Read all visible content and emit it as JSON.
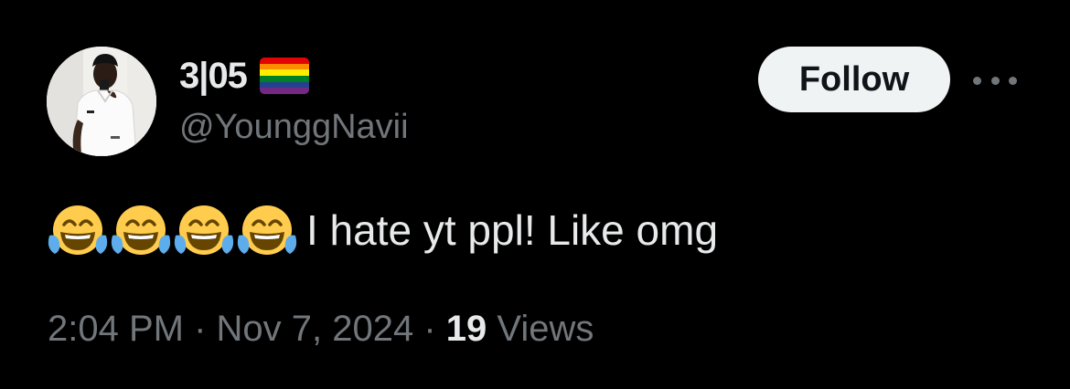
{
  "author": {
    "display_name": "3|05",
    "handle": "@YounggNavii",
    "badge_icon": "pride-flag-icon",
    "flag_colors": [
      "#e40303",
      "#ff8c00",
      "#ffed00",
      "#008026",
      "#24408e",
      "#732982"
    ]
  },
  "actions": {
    "follow_label": "Follow",
    "more_icon": "more-horizontal-icon"
  },
  "tweet": {
    "emoji_icon": "face-with-tears-of-joy-icon",
    "emoji_count": 4,
    "text": "I hate yt ppl! Like omg"
  },
  "meta": {
    "time": "2:04 PM",
    "separator": " · ",
    "date": "Nov 7, 2024",
    "views_count": "19",
    "views_label": "Views"
  },
  "colors": {
    "background": "#000000",
    "primary_text": "#e7e9ea",
    "secondary_text": "#71767b",
    "follow_bg": "#eff3f4"
  }
}
